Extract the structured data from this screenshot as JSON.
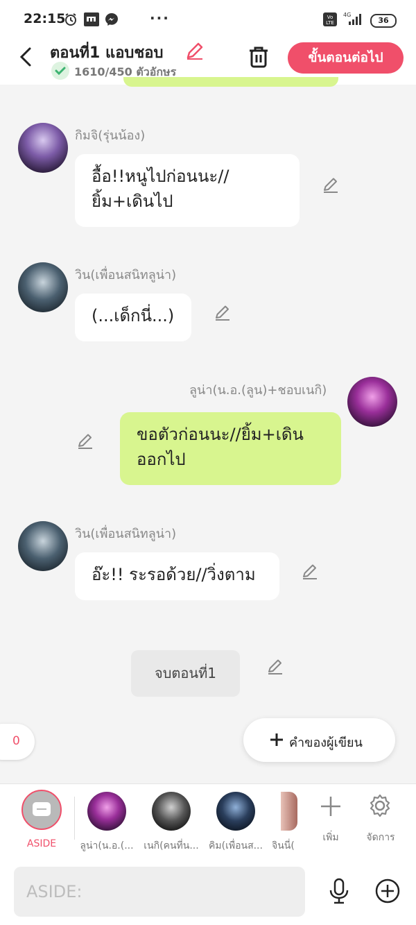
{
  "status_bar": {
    "time": "22:15",
    "battery": "36"
  },
  "header": {
    "title": "ตอนที่1 แอบชอบ",
    "char_count": "1610/450 ตัวอักษร",
    "next_button": "ขั้นตอนต่อไป"
  },
  "messages": [
    {
      "sender": "กิมจิ(รุ่นน้อง)",
      "line1": "อื้อ!!หนูไปก่อนนะ//",
      "line2": "ยิ้ม+เดินไป"
    },
    {
      "sender": "วิน(เพื่อนสนิทลูน่า)",
      "line1": "(...เด็กนี่...)"
    },
    {
      "sender": "ลูน่า(น.อ.(ลูน)+ชอบเนกิ)",
      "line1": "ขอตัวก่อนนะ//ยิ้ม+เดิน",
      "line2": "ออกไป"
    },
    {
      "sender": "วิน(เพื่อนสนิทลูน่า)",
      "line1": "อ๊ะ!! ระรอด้วย//วิ่งตาม"
    }
  ],
  "end_chip": "จบตอนที่1",
  "comment_count": "0",
  "writer_button": "คำของผู้เขียน",
  "character_bar": {
    "aside_label": "ASIDE",
    "characters": [
      "ลูน่า(น.อ.(...",
      "เนกิ(คนที่น...",
      "คิม(เพื่อนส...",
      "จินนี่("
    ],
    "add_label": "เพิ่ม",
    "manage_label": "จัดการ"
  },
  "input": {
    "placeholder": "ASIDE:"
  },
  "colors": {
    "accent": "#f04f6a",
    "bubble_green": "#d8f58f",
    "background": "#f4f4f4"
  }
}
